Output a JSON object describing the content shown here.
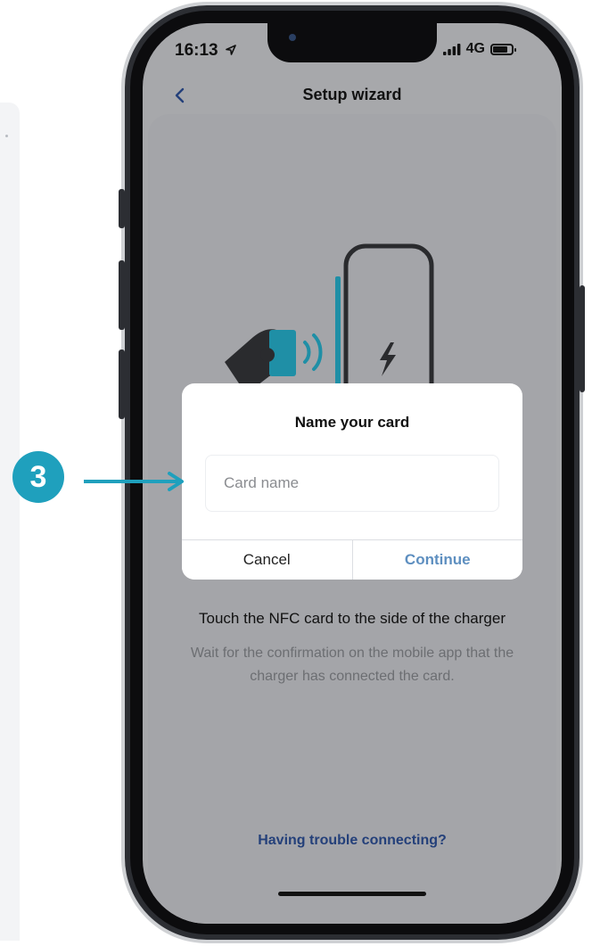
{
  "status_bar": {
    "time": "16:13",
    "signal_text": "4G"
  },
  "nav": {
    "title": "Setup wizard"
  },
  "dialog": {
    "title": "Name your card",
    "input_placeholder": "Card name",
    "input_value": "",
    "cancel_label": "Cancel",
    "continue_label": "Continue"
  },
  "content": {
    "heading": "Touch the NFC card to the side of the charger",
    "subtext": "Wait for the confirmation on the mobile app that the charger has connected the card.",
    "trouble_link": "Having trouble connecting?"
  },
  "annotation": {
    "step_number": "3"
  },
  "colors": {
    "accent": "#1fa0bd",
    "link": "#24407a",
    "continue": "#5e8fc0",
    "overlay": "#a7a8ab"
  },
  "icons": {
    "back": "chevron-left-icon",
    "location": "location-arrow-icon",
    "signal": "signal-bars-icon",
    "battery": "battery-icon",
    "bolt": "lightning-bolt-icon",
    "nfc": "nfc-waves-icon"
  }
}
